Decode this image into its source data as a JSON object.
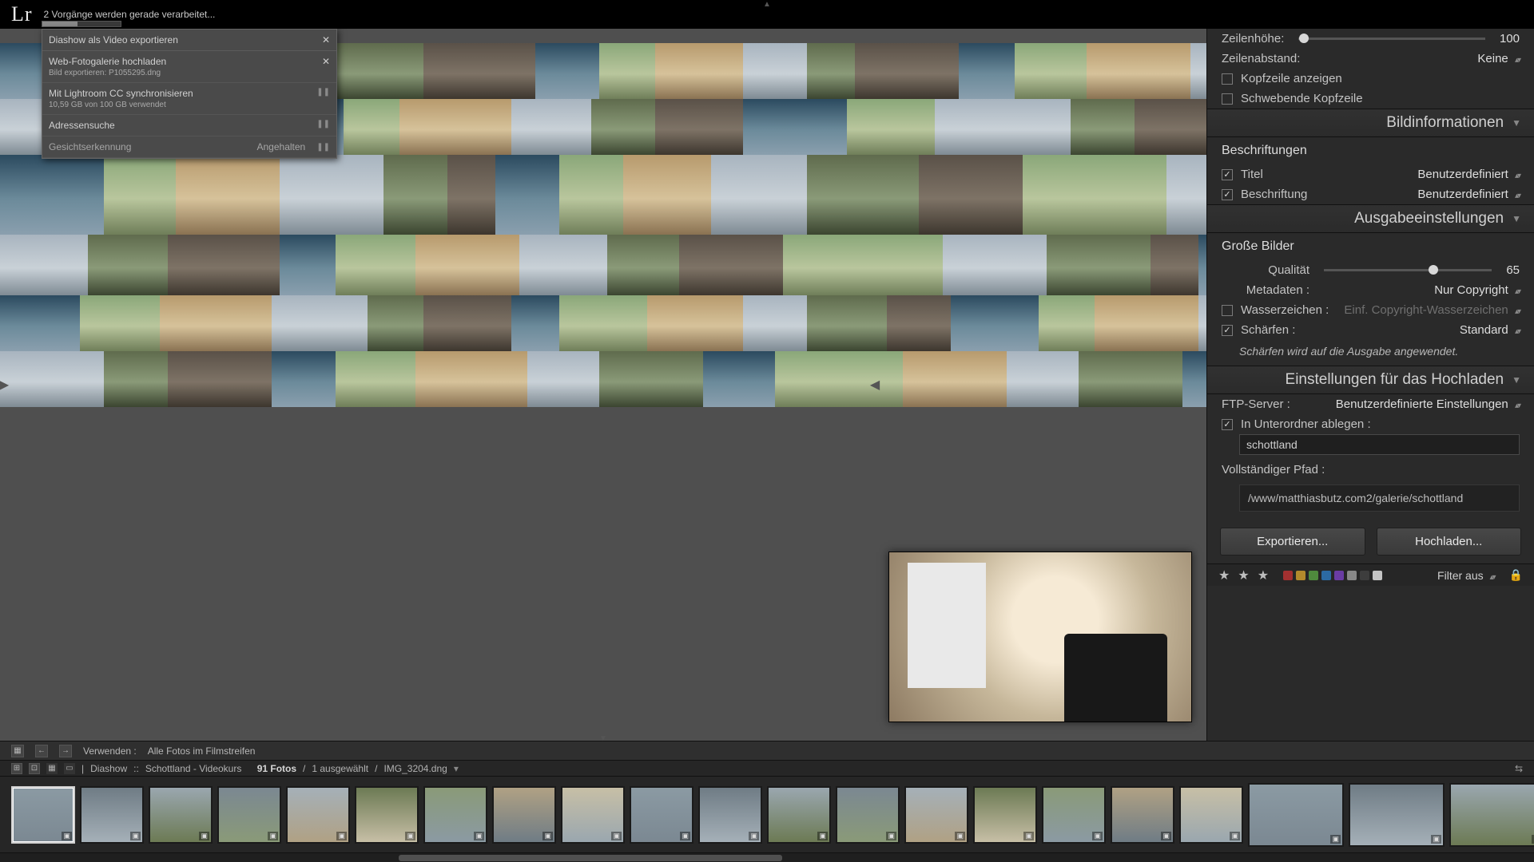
{
  "titlebar": {
    "logo": "Lr",
    "status_text": "2 Vorgänge werden gerade verarbeitet..."
  },
  "activity_panel": {
    "header": "Diashow als Video exportieren",
    "rows": [
      {
        "title": "Web-Fotogalerie hochladen",
        "sub": "Bild exportieren: P1055295.dng",
        "action": "x"
      },
      {
        "title": "Mit Lightroom CC synchronisieren",
        "sub": "10,59 GB von 100 GB verwendet",
        "action": "pause"
      },
      {
        "title": "Adressensuche",
        "sub": "",
        "action": "pause"
      },
      {
        "title": "Gesichtserkennung",
        "sub": "",
        "action": "paused",
        "status": "Angehalten"
      }
    ]
  },
  "right_panel": {
    "rowheight": {
      "label": "Zeilenhöhe:",
      "value": "100",
      "knob_pct": 3
    },
    "rowspacing": {
      "label": "Zeilenabstand:",
      "value": "Keine"
    },
    "show_header": {
      "checked": false,
      "label": "Kopfzeile anzeigen"
    },
    "floating_header": {
      "checked": false,
      "label": "Schwebende Kopfzeile",
      "disabled": true
    },
    "sections": {
      "image_info": "Bildinformationen",
      "output": "Ausgabeeinstellungen",
      "upload": "Einstellungen für das Hochladen"
    },
    "captions_title": "Beschriftungen",
    "title_cb": {
      "checked": true,
      "label": "Titel",
      "value": "Benutzerdefiniert"
    },
    "caption_cb": {
      "checked": true,
      "label": "Beschriftung",
      "value": "Benutzerdefiniert"
    },
    "large_images_title": "Große Bilder",
    "quality": {
      "label": "Qualität",
      "value": "65",
      "knob_pct": 65
    },
    "metadata": {
      "label": "Metadaten :",
      "value": "Nur Copyright"
    },
    "watermark": {
      "checked": false,
      "label": "Wasserzeichen :",
      "value": "Einf. Copyright-Wasserzeichen",
      "disabled": true
    },
    "sharpen": {
      "checked": true,
      "label": "Schärfen :",
      "value": "Standard"
    },
    "sharpen_info": "Schärfen wird auf die Ausgabe angewendet.",
    "ftp": {
      "label": "FTP-Server :",
      "value": "Benutzerdefinierte Einstellungen"
    },
    "subfolder_cb": {
      "checked": true,
      "label": "In Unterordner ablegen :"
    },
    "subfolder_value": "schottland",
    "fullpath_label": "Vollständiger Pfad :",
    "fullpath_value": "/www/matthiasbutz.com2/galerie/schottland",
    "export_btn": "Exportieren...",
    "upload_btn": "Hochladen..."
  },
  "rating_strip": {
    "stars": 3,
    "colors": [
      "#a23030",
      "#b38a2c",
      "#4f8a3d",
      "#2c6aa3",
      "#6a3ca3",
      "#888888",
      "#3d3d3d",
      "#c4c4c4"
    ],
    "filter_label": "Filter aus"
  },
  "filmstrip_toolbar": {
    "use_label": "Verwenden :",
    "use_value": "Alle Fotos im Filmstreifen"
  },
  "collection_info": {
    "module": "Diashow",
    "collection": "Schottland - Videokurs",
    "count_label": "91 Fotos",
    "sel_label": "1 ausgewählt",
    "current": "IMG_3204.dng"
  },
  "filmstrip": {
    "count": 22,
    "aux_count": 4
  }
}
